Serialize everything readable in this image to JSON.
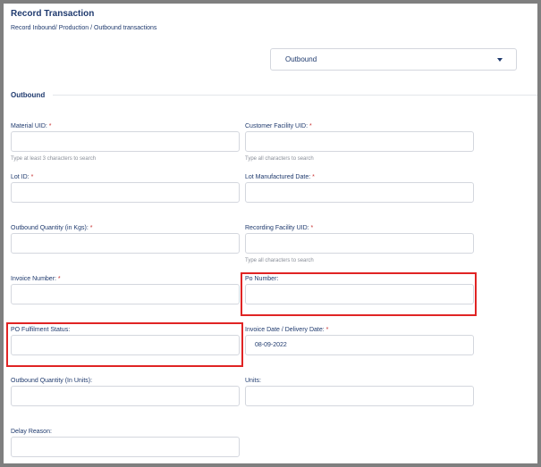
{
  "header": {
    "title": "Record Transaction",
    "subtitle": "Record Inbound/ Production / Outbound transactions"
  },
  "transaction_type": {
    "selected": "Outbound",
    "icon": "chevron-down-icon"
  },
  "section": {
    "title": "Outbound"
  },
  "fields": {
    "material_uid": {
      "label": "Material UID: ",
      "required": "*",
      "value": "",
      "hint": "Type at least 3 characters to search"
    },
    "customer_facility_uid": {
      "label": "Customer Facility UID: ",
      "required": "*",
      "value": "",
      "hint": "Type all characters to search"
    },
    "lot_id": {
      "label": "Lot ID: ",
      "required": "*",
      "value": ""
    },
    "lot_manufactured_date": {
      "label": "Lot Manufactured Date: ",
      "required": "*",
      "value": ""
    },
    "outbound_quantity_kgs": {
      "label": "Outbound Quantity (in Kgs): ",
      "required": "*",
      "value": ""
    },
    "recording_facility_uid": {
      "label": "Recording Facility UID: ",
      "required": "*",
      "value": "",
      "hint": "Type all characters to search"
    },
    "invoice_number": {
      "label": "Invoice Number: ",
      "required": "*",
      "value": ""
    },
    "po_number": {
      "label": "Po Number:",
      "value": ""
    },
    "po_fulfilment_status": {
      "label": "PO Fulfilment Status:",
      "value": ""
    },
    "invoice_date": {
      "label": "Invoice Date / Delivery Date: ",
      "required": "*",
      "value": "08-09-2022"
    },
    "outbound_quantity_units": {
      "label": "Outbound Quantity (In Units):",
      "value": ""
    },
    "units": {
      "label": "Units:",
      "value": ""
    },
    "delay_reason": {
      "label": "Delay Reason:",
      "value": ""
    }
  },
  "colors": {
    "accent": "#1f3a6e",
    "required": "#c83232",
    "highlight": "#e02424",
    "border": "#d4d7de"
  }
}
